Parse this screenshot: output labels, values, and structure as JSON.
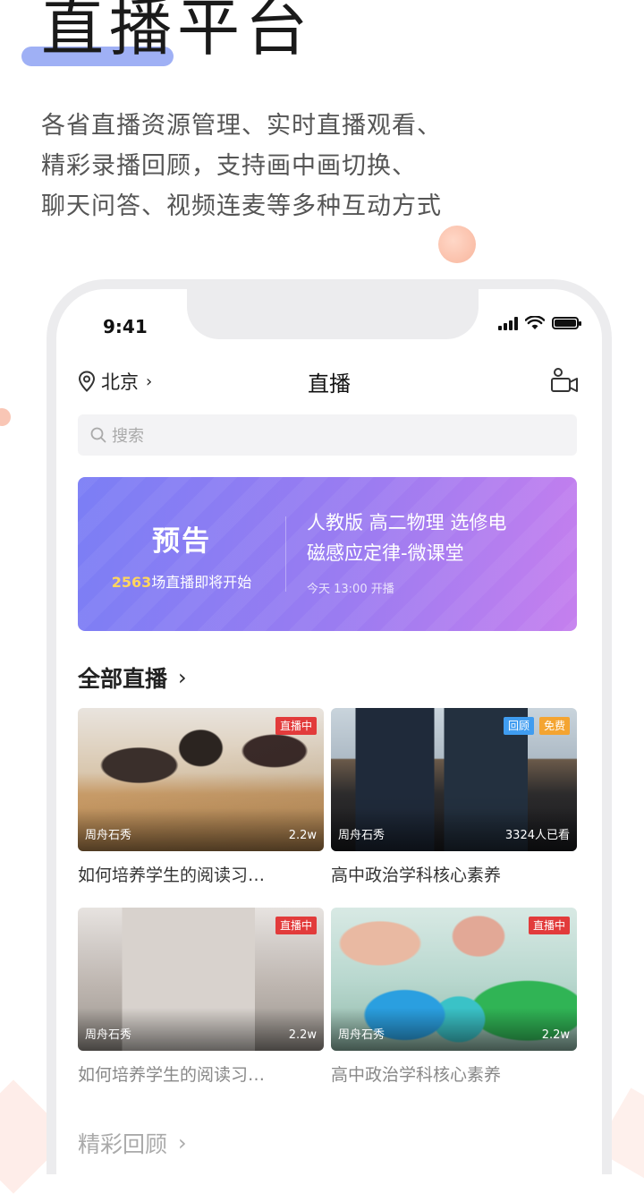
{
  "promo": {
    "title": "直播平台",
    "desc_lines": [
      "各省直播资源管理、实时直播观看、",
      "精彩录播回顾，支持画中画切换、",
      "聊天问答、视频连麦等多种互动方式"
    ]
  },
  "status_bar": {
    "time": "9:41"
  },
  "nav": {
    "location": "北京",
    "title": "直播",
    "location_icon": "location-pin-icon",
    "camera_icon": "video-camera-icon"
  },
  "search": {
    "placeholder": "搜索"
  },
  "banner": {
    "tag": "预告",
    "count": "2563",
    "count_suffix": "场直播即将开始",
    "course_line1": "人教版 高二物理 选修电",
    "course_line2": "磁感应定律-微课堂",
    "time": "今天 13:00 开播"
  },
  "sections": {
    "all_live": "全部直播",
    "replay": "精彩回顾"
  },
  "cards": [
    {
      "badges": [
        "直播中"
      ],
      "author": "周舟石秀",
      "views": "2.2w",
      "title": "如何培养学生的阅读习…"
    },
    {
      "badges": [
        "回顾",
        "免费"
      ],
      "author": "周舟石秀",
      "views": "3324人已看",
      "title": "高中政治学科核心素养"
    },
    {
      "badges": [
        "直播中"
      ],
      "author": "周舟石秀",
      "views": "2.2w",
      "title": "如何培养学生的阅读习…"
    },
    {
      "badges": [
        "直播中"
      ],
      "author": "周舟石秀",
      "views": "2.2w",
      "title": "高中政治学科核心素养"
    }
  ],
  "colors": {
    "accent_underline": "#9fb0f5",
    "banner_start": "#7b7ef5",
    "banner_end": "#c57fee",
    "live_badge": "#e23b3b",
    "replay_badge": "#3f9cf0",
    "free_badge": "#f4a431",
    "count_highlight": "#ffd55e"
  }
}
